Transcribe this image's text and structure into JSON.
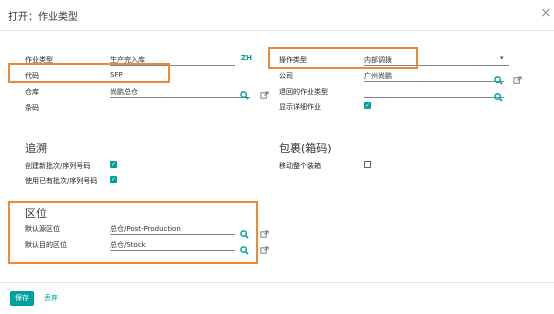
{
  "dialog": {
    "title": "打开：作业类型",
    "close_glyph": "×"
  },
  "general": {
    "operation_type_label": "作业类型",
    "operation_type_value": "生产完入库",
    "lang_badge": "ZH",
    "code_label": "代码",
    "code_value": "SFP",
    "warehouse_label": "仓库",
    "warehouse_value": "尚鹏总仓",
    "barcode_label": "条码",
    "type_of_operation_label": "操作类型",
    "type_of_operation_value": "内部调拨",
    "company_label": "公司",
    "company_value": "广州尚鹏",
    "return_type_label": "退回的作业类型",
    "show_detailed_label": "显示详细作业",
    "show_detailed_checked": true
  },
  "traceability": {
    "title": "追溯",
    "create_lots_label": "创建新批次/序列号码",
    "create_lots_checked": true,
    "use_existing_label": "使用已有批次/序列号码",
    "use_existing_checked": true
  },
  "packages": {
    "title": "包裹(箱码)",
    "move_entire_label": "移动整个装箱",
    "move_entire_checked": false
  },
  "locations": {
    "title": "区位",
    "src_label": "默认源区位",
    "src_value": "总仓/Post-Production",
    "dest_label": "默认目的区位",
    "dest_value": "总仓/Stock"
  },
  "footer": {
    "save_label": "保存",
    "discard_label": "丢弃"
  },
  "icons": {
    "search": "search-icon",
    "external": "external-link-icon",
    "check": "✓"
  },
  "colors": {
    "accent": "#00a09d",
    "highlight": "#f0883a"
  }
}
